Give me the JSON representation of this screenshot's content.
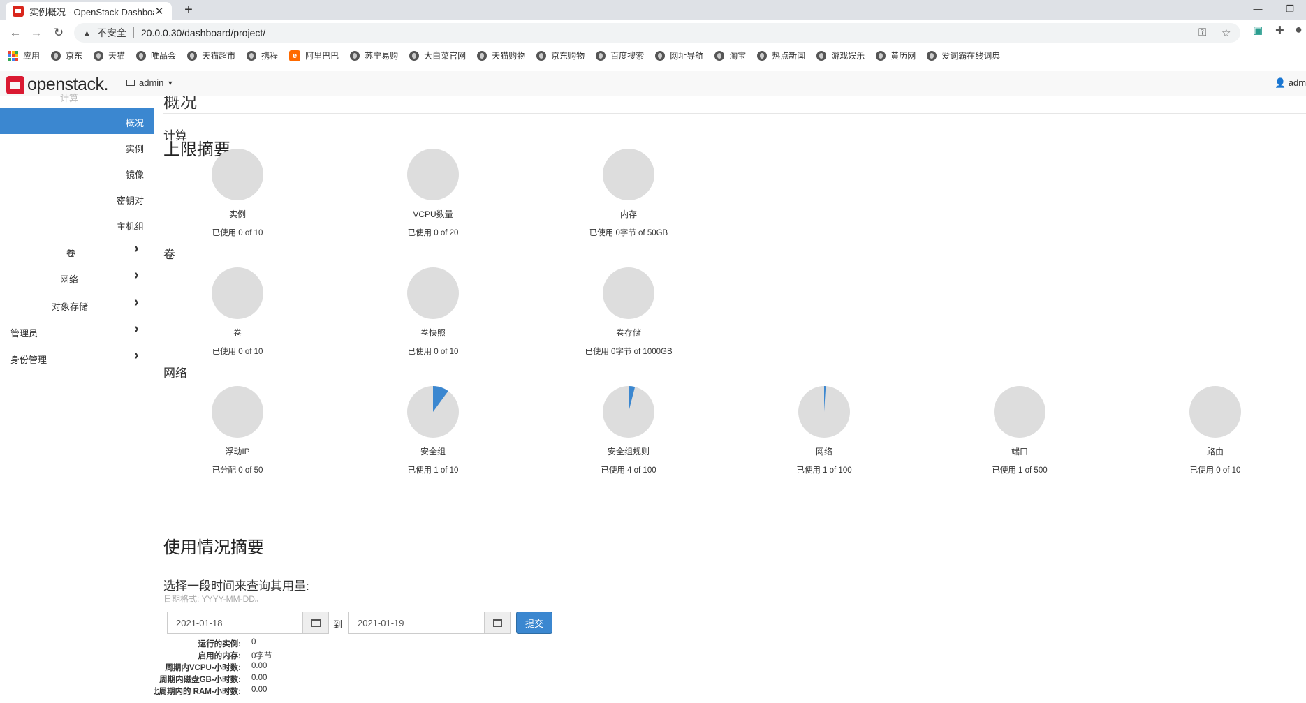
{
  "browser": {
    "tab_title": "实例概况 - OpenStack Dashboard",
    "insecure_label": "不安全",
    "url": "20.0.0.30/dashboard/project/",
    "bookmarks": [
      "应用",
      "京东",
      "天猫",
      "唯品会",
      "天猫超市",
      "携程",
      "阿里巴巴",
      "苏宁易购",
      "大白菜官网",
      "天猫购物",
      "京东购物",
      "百度搜索",
      "网址导航",
      "淘宝",
      "热点新闻",
      "游戏娱乐",
      "黄历网",
      "爱词霸在线词典"
    ]
  },
  "header": {
    "logo_text": "openstack.",
    "project": "admin",
    "user": "admin"
  },
  "sidebar": {
    "ghost_top": "计算",
    "items": [
      {
        "label": "概况",
        "active": true
      },
      {
        "label": "实例"
      },
      {
        "label": "镜像"
      },
      {
        "label": "密钥对"
      },
      {
        "label": "主机组"
      },
      {
        "label": "卷"
      },
      {
        "label": "网络"
      },
      {
        "label": "对象存储"
      },
      {
        "label": "管理员"
      },
      {
        "label": "身份管理"
      }
    ]
  },
  "content": {
    "page_title": "概况",
    "limit_summary_title": "上限摘要",
    "sections": [
      {
        "title": "计算",
        "charts": [
          {
            "label": "实例",
            "usage": "已使用 0 of 10",
            "fraction": 0
          },
          {
            "label": "VCPU数量",
            "usage": "已使用 0 of 20",
            "fraction": 0
          },
          {
            "label": "内存",
            "usage": "已使用 0字节 of 50GB",
            "fraction": 0
          }
        ]
      },
      {
        "title": "卷",
        "charts": [
          {
            "label": "卷",
            "usage": "已使用 0 of 10",
            "fraction": 0
          },
          {
            "label": "卷快照",
            "usage": "已使用 0 of 10",
            "fraction": 0
          },
          {
            "label": "卷存储",
            "usage": "已使用 0字节 of 1000GB",
            "fraction": 0
          }
        ]
      },
      {
        "title": "网络",
        "charts": [
          {
            "label": "浮动IP",
            "usage": "已分配 0 of 50",
            "fraction": 0
          },
          {
            "label": "安全组",
            "usage": "已使用 1 of 10",
            "fraction": 0.1
          },
          {
            "label": "安全组规则",
            "usage": "已使用 4 of 100",
            "fraction": 0.04
          },
          {
            "label": "网络",
            "usage": "已使用 1 of 100",
            "fraction": 0.01
          },
          {
            "label": "端口",
            "usage": "已使用 1 of 500",
            "fraction": 0.002
          },
          {
            "label": "路由",
            "usage": "已使用 0 of 10",
            "fraction": 0
          }
        ]
      }
    ],
    "usage_summary_title": "使用情况摘要",
    "period_label": "选择一段时间来查询其用量:",
    "date_hint": "日期格式: YYYY-MM-DD。",
    "start_date": "2021-01-18",
    "to_label": "到",
    "end_date": "2021-01-19",
    "submit_label": "提交",
    "stats": [
      {
        "key": "运行的实例:",
        "value": "0"
      },
      {
        "key": "启用的内存:",
        "value": "0字节"
      },
      {
        "key": "周期内VCPU-小时数:",
        "value": "0.00"
      },
      {
        "key": "周期内磁盘GB-小时数:",
        "value": "0.00"
      },
      {
        "key": "此周期内的 RAM-小时数:",
        "value": "0.00"
      }
    ]
  },
  "colors": {
    "accent": "#3b87d0",
    "pie_empty": "#dddddd",
    "logo_red": "#da1a32"
  }
}
